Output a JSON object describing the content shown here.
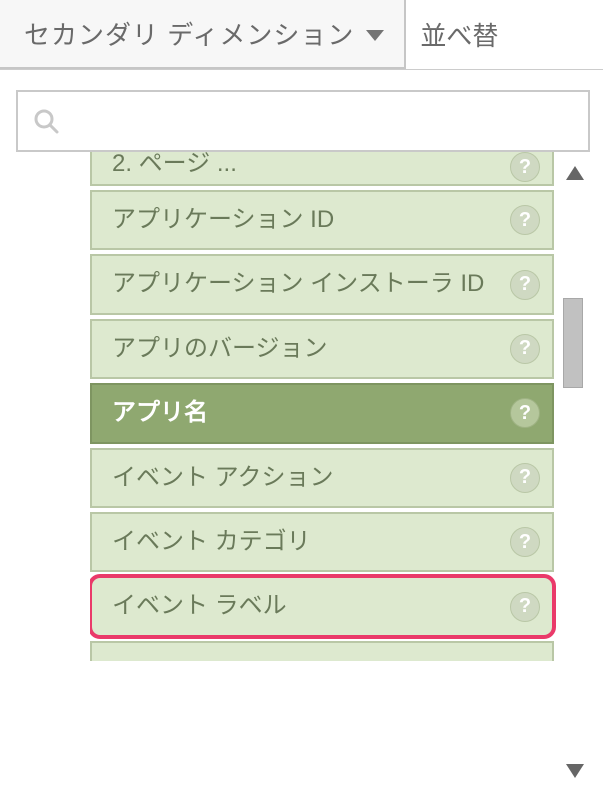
{
  "topbar": {
    "dropdown_label": "セカンダリ ディメンション",
    "sort_label": "並べ替"
  },
  "search": {
    "placeholder": ""
  },
  "list": {
    "items": [
      {
        "label": "2. ページ ...",
        "partial": true,
        "selected": false,
        "highlighted": false
      },
      {
        "label": "アプリケーション ID",
        "partial": false,
        "selected": false,
        "highlighted": false
      },
      {
        "label": "アプリケーション インストーラ ID",
        "partial": false,
        "selected": false,
        "highlighted": false
      },
      {
        "label": "アプリのバージョン",
        "partial": false,
        "selected": false,
        "highlighted": false
      },
      {
        "label": "アプリ名",
        "partial": false,
        "selected": true,
        "highlighted": false
      },
      {
        "label": "イベント アクション",
        "partial": false,
        "selected": false,
        "highlighted": false
      },
      {
        "label": "イベント カテゴリ",
        "partial": false,
        "selected": false,
        "highlighted": false
      },
      {
        "label": "イベント ラベル",
        "partial": false,
        "selected": false,
        "highlighted": true
      }
    ]
  },
  "help_glyph": "?"
}
